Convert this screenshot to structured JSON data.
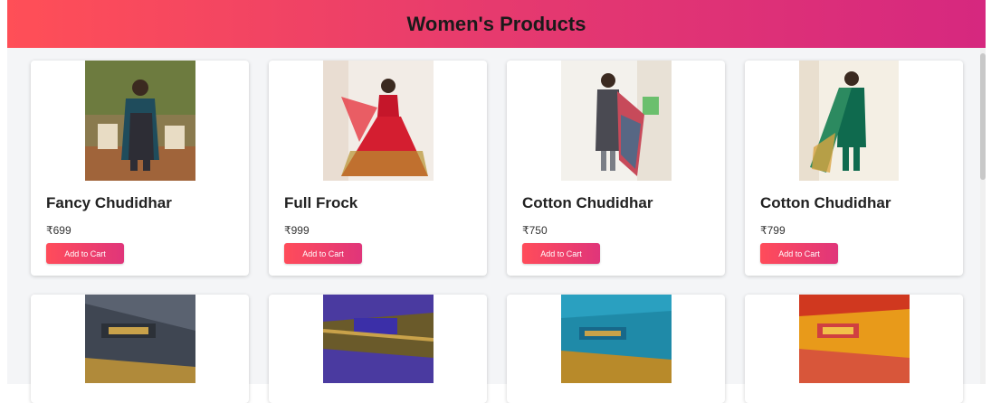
{
  "header": {
    "title": "Women's Products"
  },
  "products": [
    {
      "name": "Fancy Chudidhar",
      "price": "₹699",
      "button": "Add to Cart"
    },
    {
      "name": "Full Frock",
      "price": "₹999",
      "button": "Add to Cart"
    },
    {
      "name": "Cotton Chudidhar",
      "price": "₹750",
      "button": "Add to Cart"
    },
    {
      "name": "Cotton Chudidhar",
      "price": "₹799",
      "button": "Add to Cart"
    }
  ],
  "colors": {
    "header_start": "#ff4f57",
    "header_end": "#d6287f",
    "button": "#e8406a"
  }
}
